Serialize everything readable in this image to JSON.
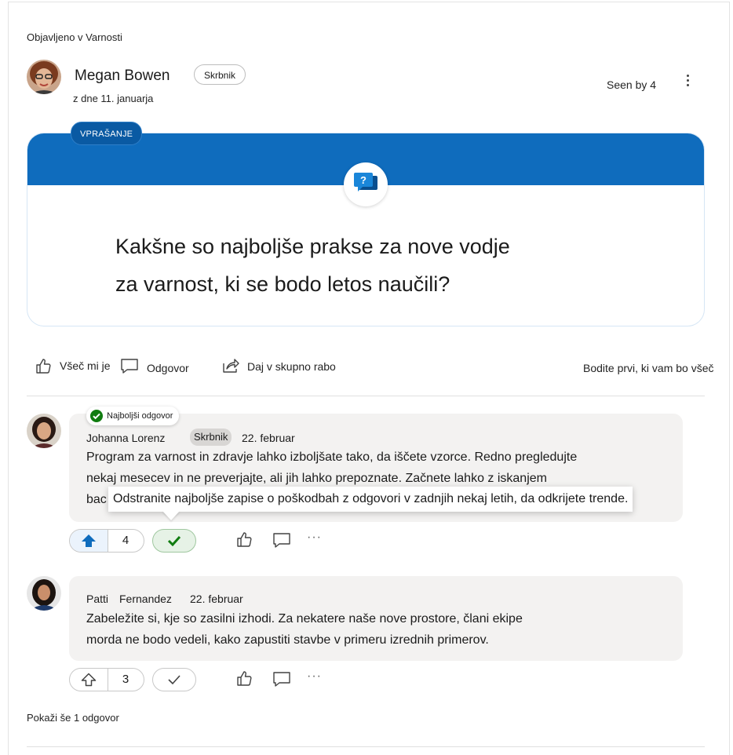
{
  "post": {
    "posted_in": "Objavljeno v Varnosti",
    "author": "Megan Bowen",
    "role": "Skrbnik",
    "date": "z dne 11. januarja",
    "seen": "Seen by 4"
  },
  "question": {
    "badge": "VPRAŠANJE",
    "text_line1": "Kakšne so najboljše prakse za nove vodje",
    "text_line2": "za varnost, ki se bodo letos naučili?"
  },
  "actions": {
    "like": "Všeč mi je",
    "reply": "Odgovor",
    "share": "Daj v skupno rabo",
    "first_like": "Bodite prvi, ki vam bo všeč"
  },
  "replies": [
    {
      "best_label": "Najboljši odgovor",
      "author": "Johanna Lorenz",
      "role": "Skrbnik",
      "date": "22. februar",
      "line1": "Program za varnost in zdravje lahko izboljšate tako, da iščete vzorce. Redno pregledujte",
      "line2": "nekaj mesecev in ne preverjajte, ali jih lahko prepoznate. Začnete lahko z iskanjem",
      "line3_start": "bac",
      "line3_rest": "Odstranite najboljše zapise o poškodbah z odgovori v zadnjih nekaj letih, da odkrijete trende.",
      "votes": "4"
    },
    {
      "author_first": "Patti",
      "author_last": "Fernandez",
      "date": "22. februar",
      "line1": "Zabeležite si, kje so zasilni izhodi. Za nekatere naše nove prostore, člani ekipe",
      "line2": "morda ne bodo vedeli, kako zapustiti stavbe v primeru izrednih primerov.",
      "votes": "3"
    }
  ],
  "show_more": "Pokaži še 1 odgovor",
  "colors": {
    "accent": "#0f6cbd",
    "best_green": "#107c10"
  }
}
